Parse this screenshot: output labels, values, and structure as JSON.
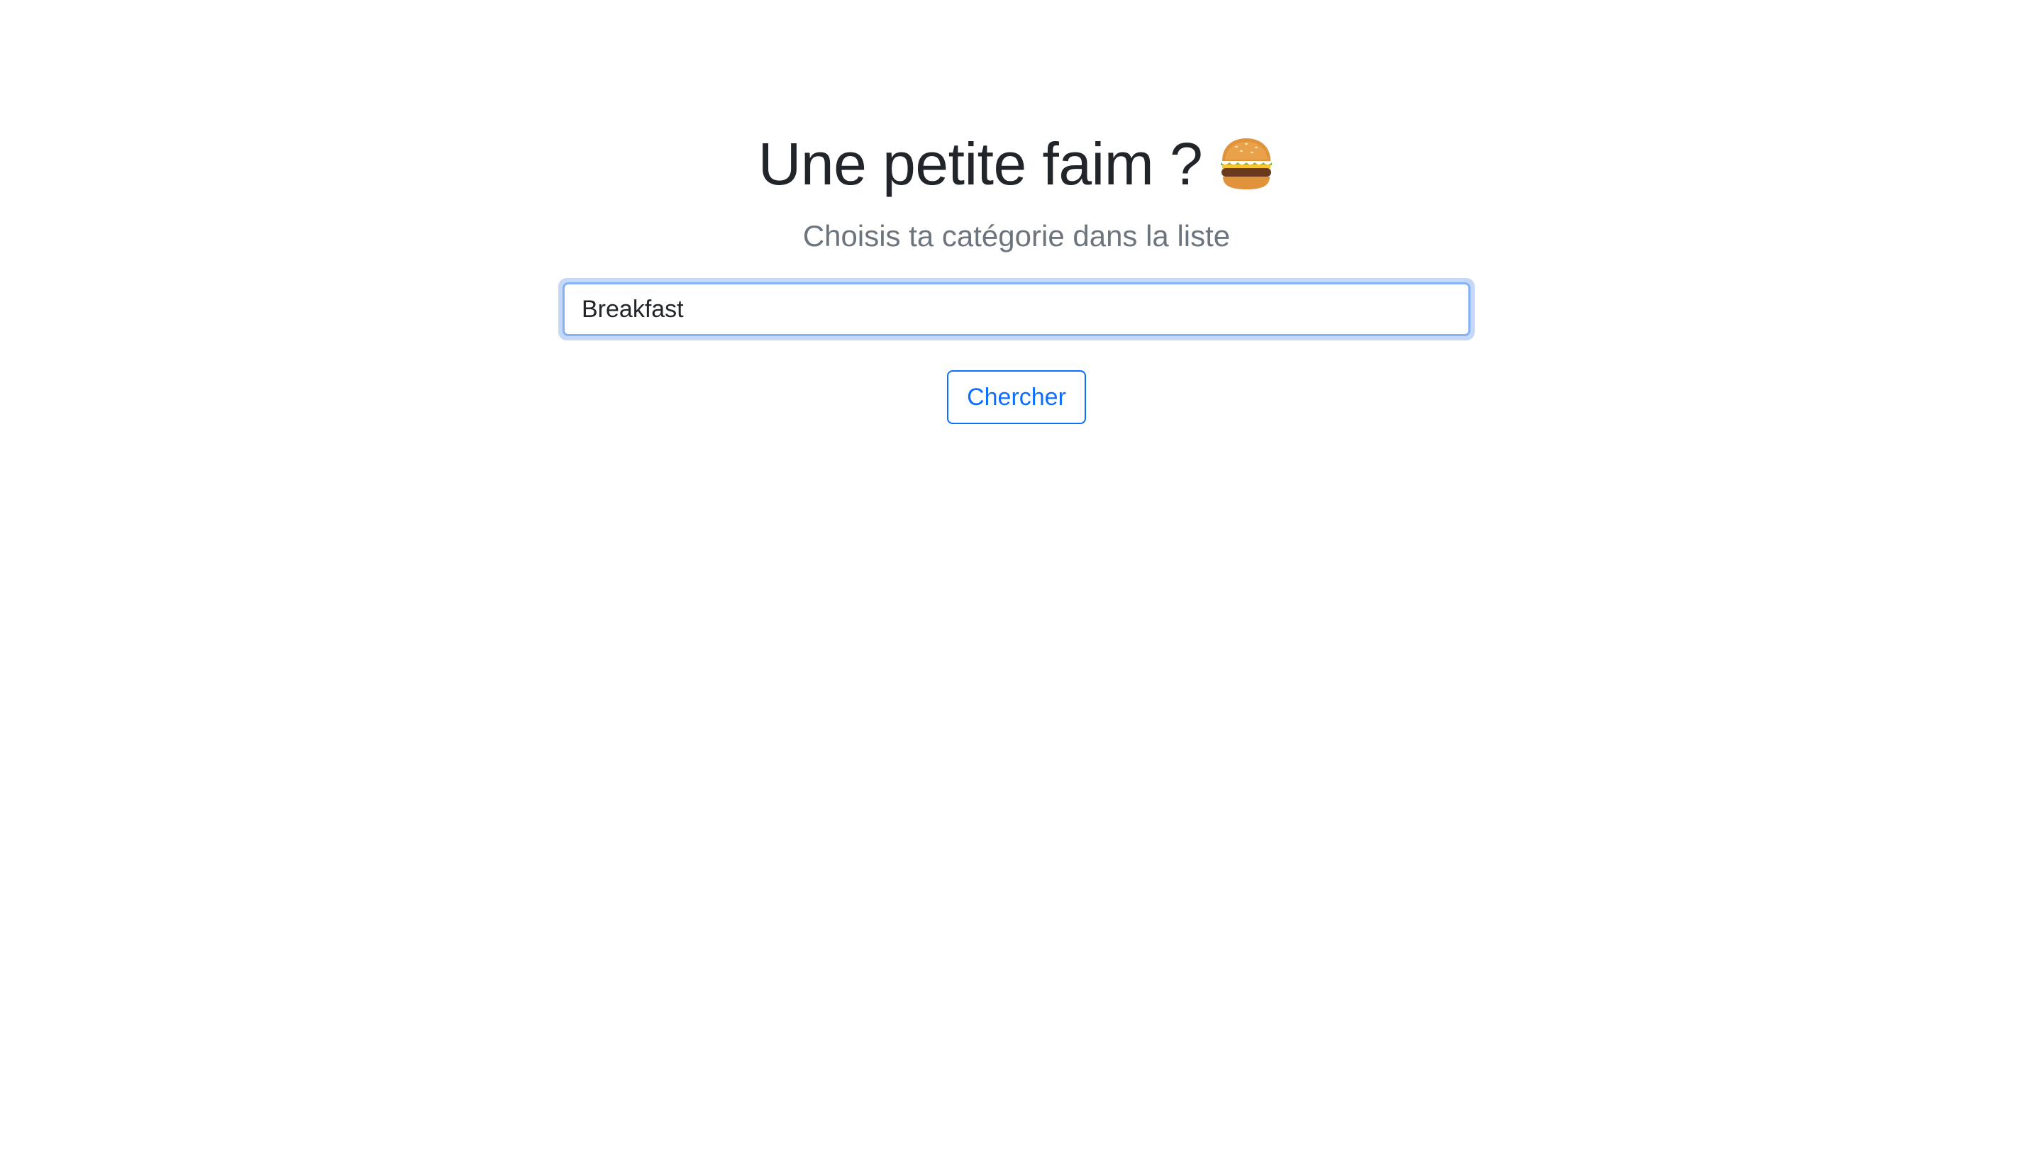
{
  "hero": {
    "title": "Une petite faim ?",
    "title_icon": "burger-emoji",
    "subtitle": "Choisis ta catégorie dans la liste"
  },
  "search": {
    "value": "Breakfast",
    "button_label": "Chercher"
  },
  "colors": {
    "accent": "#0d6efd",
    "title": "#212529",
    "subtitle": "#6c757d",
    "focus_ring": "#c6d8f8"
  }
}
